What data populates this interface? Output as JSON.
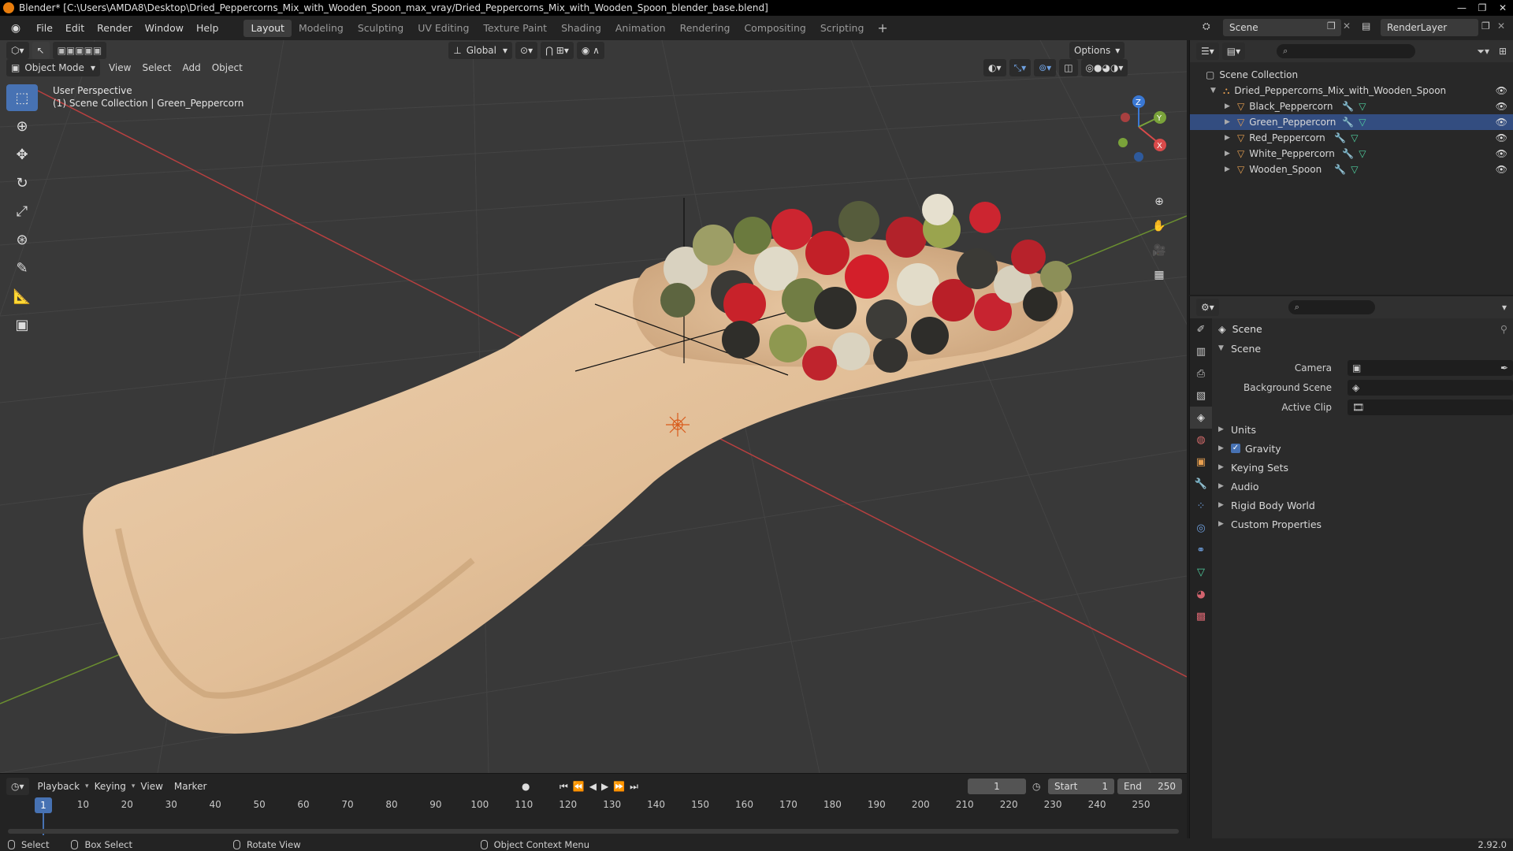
{
  "window": {
    "title": "Blender* [C:\\Users\\AMDA8\\Desktop\\Dried_Peppercorns_Mix_with_Wooden_Spoon_max_vray/Dried_Peppercorns_Mix_with_Wooden_Spoon_blender_base.blend]",
    "minimize": "—",
    "maximize": "❐",
    "close": "✕"
  },
  "menu": [
    "File",
    "Edit",
    "Render",
    "Window",
    "Help"
  ],
  "workspaces": [
    "Layout",
    "Modeling",
    "Sculpting",
    "UV Editing",
    "Texture Paint",
    "Shading",
    "Animation",
    "Rendering",
    "Compositing",
    "Scripting"
  ],
  "active_workspace": "Layout",
  "scene_name": "Scene",
  "view_layer": "RenderLayer",
  "viewport": {
    "mode": "Object Mode",
    "menus": [
      "View",
      "Select",
      "Add",
      "Object"
    ],
    "transform_orientation": "Global",
    "options_label": "Options",
    "overlay_line1": "User Perspective",
    "overlay_line2": "(1) Scene Collection | Green_Peppercorn",
    "gizmo_axes": {
      "x": "X",
      "y": "Y",
      "z": "Z"
    }
  },
  "outliner": {
    "root": "Scene Collection",
    "collection": "Dried_Peppercorns_Mix_with_Wooden_Spoon",
    "objects": [
      "Black_Peppercorn",
      "Green_Peppercorn",
      "Red_Peppercorn",
      "White_Peppercorn",
      "Wooden_Spoon"
    ],
    "selected": "Green_Peppercorn"
  },
  "properties": {
    "context_title": "Scene",
    "panel_title": "Scene",
    "fields": [
      {
        "label": "Camera",
        "value": ""
      },
      {
        "label": "Background Scene",
        "value": ""
      },
      {
        "label": "Active Clip",
        "value": ""
      }
    ],
    "subpanels": [
      "Units",
      "Gravity",
      "Keying Sets",
      "Audio",
      "Rigid Body World",
      "Custom Properties"
    ],
    "gravity_checked": true
  },
  "timeline": {
    "menus": [
      "Playback",
      "Keying",
      "View",
      "Marker"
    ],
    "current_frame": "1",
    "start_label": "Start",
    "start": "1",
    "end_label": "End",
    "end": "250",
    "ticks": [
      "10",
      "20",
      "30",
      "40",
      "50",
      "60",
      "70",
      "80",
      "90",
      "100",
      "110",
      "120",
      "130",
      "140",
      "150",
      "160",
      "170",
      "180",
      "190",
      "200",
      "210",
      "220",
      "230",
      "240",
      "250"
    ]
  },
  "statusbar": {
    "select": "Select",
    "box_select": "Box Select",
    "rotate_view": "Rotate View",
    "context_menu": "Object Context Menu",
    "version": "2.92.0"
  },
  "colors": {
    "accent": "#4772b3",
    "x_axis": "#d94a4a",
    "y_axis": "#7aa33a",
    "z_axis": "#3a78d4",
    "spoon": "#e3c19c"
  }
}
